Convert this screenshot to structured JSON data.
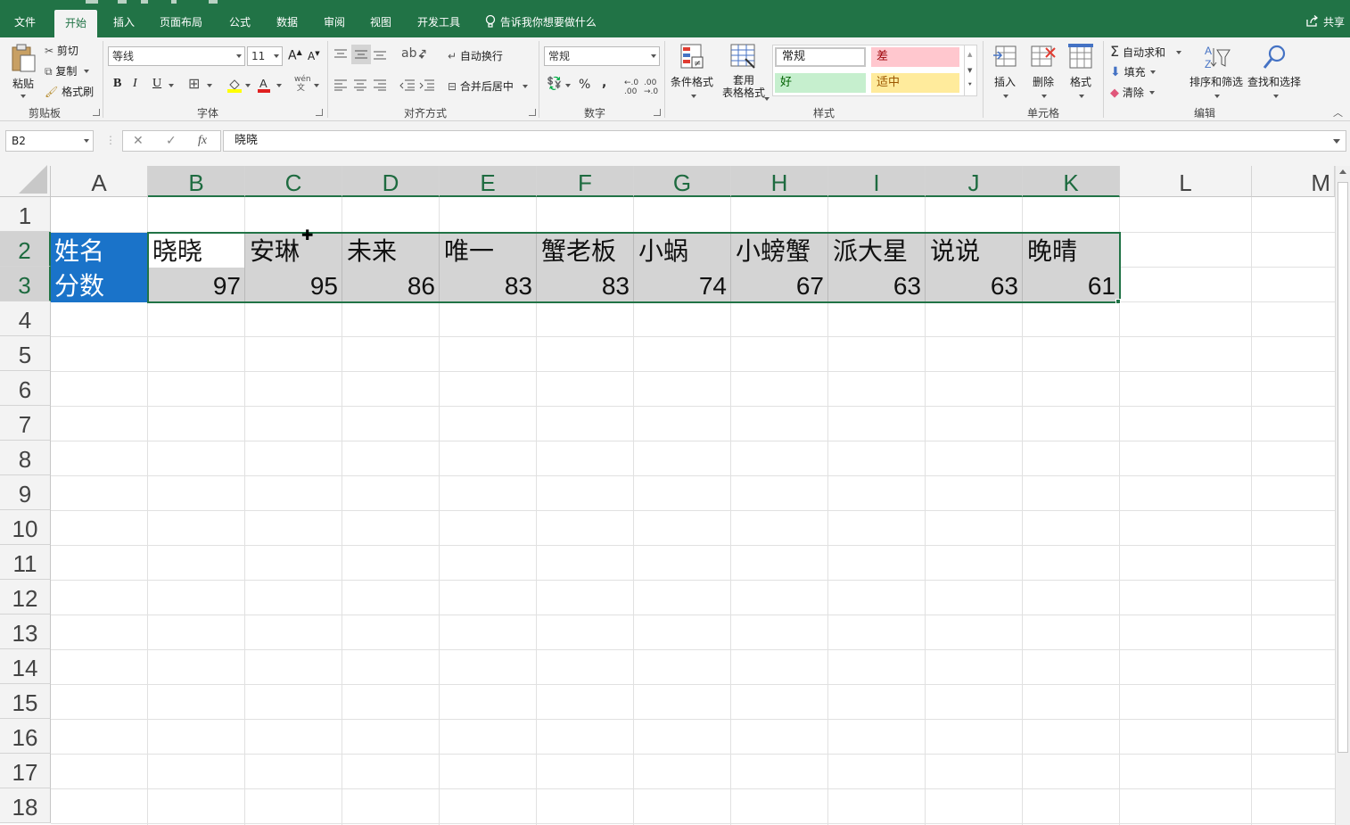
{
  "menu": {
    "tabs": [
      "文件",
      "开始",
      "插入",
      "页面布局",
      "公式",
      "数据",
      "审阅",
      "视图",
      "开发工具"
    ],
    "active_tab": "开始",
    "tell_me": "告诉我你想要做什么",
    "share": "共享"
  },
  "ribbon": {
    "clipboard": {
      "paste": "粘贴",
      "cut": "剪切",
      "copy": "复制",
      "format_painter": "格式刷",
      "label": "剪贴板"
    },
    "font": {
      "font_name": "等线",
      "font_size": "11",
      "bold": "B",
      "italic": "I",
      "underline": "U",
      "label": "字体"
    },
    "alignment": {
      "wrap_text": "自动换行",
      "merge_center": "合并后居中",
      "label": "对齐方式"
    },
    "number": {
      "format": "常规",
      "percent": "%",
      "comma": ",",
      "label": "数字"
    },
    "styles": {
      "conditional": "条件格式",
      "table_format_1": "套用",
      "table_format_2": "表格格式",
      "cells": [
        {
          "name": "常规",
          "bg": "#ffffff",
          "fg": "#000000"
        },
        {
          "name": "差",
          "bg": "#ffc7ce",
          "fg": "#9c0006"
        },
        {
          "name": "好",
          "bg": "#c6efce",
          "fg": "#006100"
        },
        {
          "name": "适中",
          "bg": "#ffeb9c",
          "fg": "#9c5700"
        }
      ],
      "label": "样式"
    },
    "cells_group": {
      "insert": "插入",
      "delete": "删除",
      "format": "格式",
      "label": "单元格"
    },
    "editing": {
      "autosum": "自动求和",
      "fill": "填充",
      "clear": "清除",
      "sort_filter": "排序和筛选",
      "find_select": "查找和选择",
      "label": "编辑"
    }
  },
  "formula_bar": {
    "name_box": "B2",
    "fx": "fx",
    "value": "晓晓"
  },
  "sheet": {
    "columns": [
      "A",
      "B",
      "C",
      "D",
      "E",
      "F",
      "G",
      "H",
      "I",
      "J",
      "K",
      "L",
      "M"
    ],
    "rows": [
      "1",
      "2",
      "3",
      "4",
      "5",
      "6",
      "7",
      "8",
      "9",
      "10",
      "11",
      "12",
      "13",
      "14",
      "15",
      "16",
      "17",
      "18"
    ],
    "label_name": "姓名",
    "label_score": "分数",
    "names": [
      "晓晓",
      "安琳",
      "未来",
      "唯一",
      "蟹老板",
      "小蜗",
      "小螃蟹",
      "派大星",
      "说说",
      "晚晴"
    ],
    "scores": [
      "97",
      "95",
      "86",
      "83",
      "83",
      "74",
      "67",
      "63",
      "63",
      "61"
    ],
    "label_color": "#1a73c9",
    "accent": "#217346"
  }
}
